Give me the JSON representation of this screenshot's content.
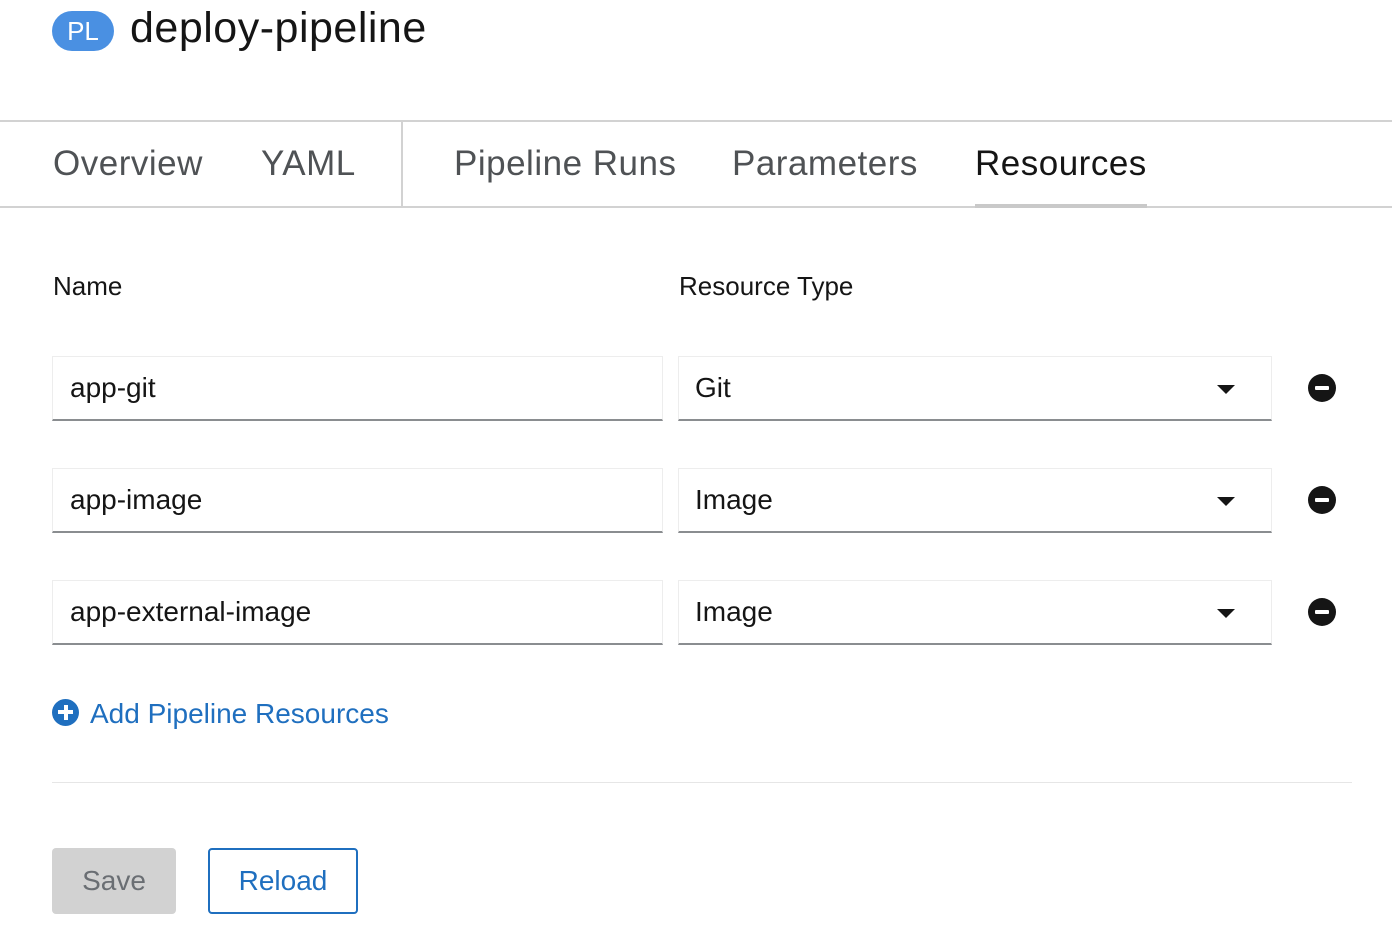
{
  "header": {
    "badge": "PL",
    "title": "deploy-pipeline"
  },
  "tabs": [
    {
      "label": "Overview",
      "active": false
    },
    {
      "label": "YAML",
      "active": false
    },
    {
      "label": "Pipeline Runs",
      "active": false
    },
    {
      "label": "Parameters",
      "active": false
    },
    {
      "label": "Resources",
      "active": true
    }
  ],
  "form": {
    "name_header": "Name",
    "type_header": "Resource Type",
    "rows": [
      {
        "name": "app-git",
        "type": "Git"
      },
      {
        "name": "app-image",
        "type": "Image"
      },
      {
        "name": "app-external-image",
        "type": "Image"
      }
    ],
    "add_label": "Add Pipeline Resources"
  },
  "actions": {
    "save_label": "Save",
    "reload_label": "Reload"
  },
  "icons": {
    "remove": "minus-circle-icon",
    "add": "plus-circle-icon",
    "dropdown": "caret-down-icon"
  },
  "colors": {
    "badge": "#4a90e2",
    "link": "#1f6fbf",
    "disabled_button": "#d2d2d2"
  }
}
